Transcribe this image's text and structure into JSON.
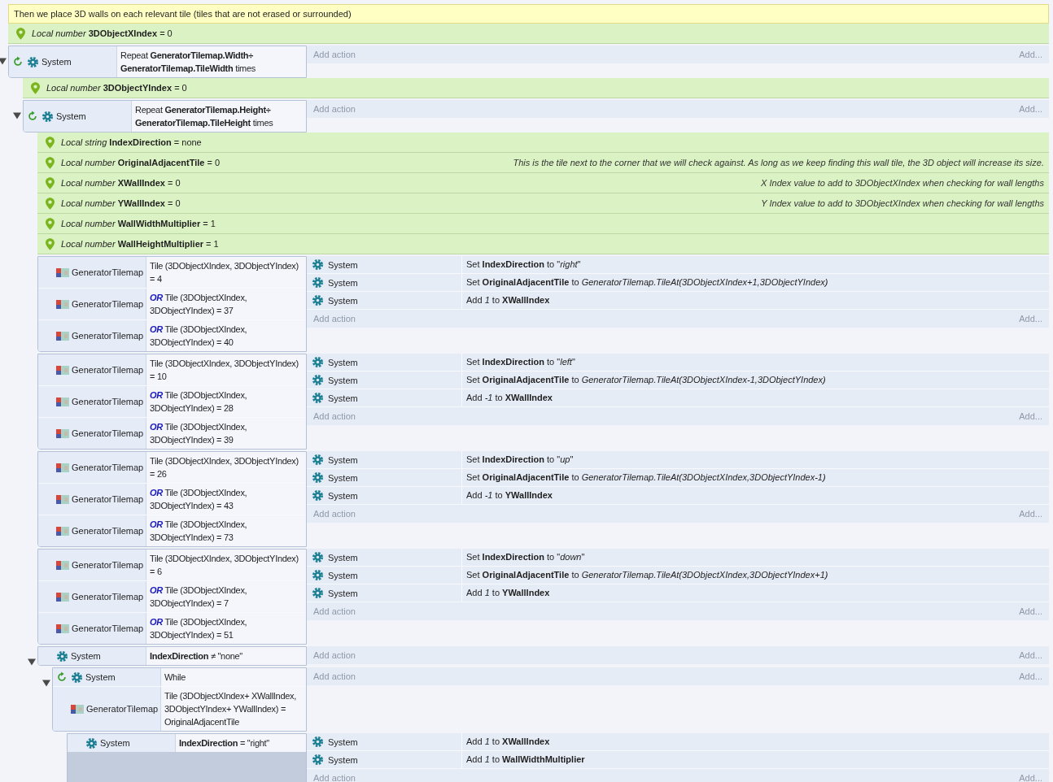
{
  "rows": [
    {
      "kind": "comment",
      "text": "Then we place 3D walls on each relevant tile (tiles that are not erased or surrounded)"
    },
    {
      "kind": "variable",
      "text": "*Local number* **3DObjectXIndex** = 0"
    },
    {
      "kind": "event",
      "expanded": true,
      "conditions": [
        {
          "kind": "system",
          "loop": true,
          "object": "System",
          "text": "Repeat **GeneratorTilemap.Width÷ GeneratorTilemap.TileWidth** times"
        }
      ],
      "add_action": "Add action",
      "add": "Add...",
      "children": [
        {
          "kind": "variable",
          "text": "*Local number* **3DObjectYIndex** = 0"
        },
        {
          "kind": "event",
          "expanded": true,
          "conditions": [
            {
              "kind": "system",
              "loop": true,
              "object": "System",
              "text": "Repeat **GeneratorTilemap.Height÷ GeneratorTilemap.TileHeight** times"
            }
          ],
          "add_action": "Add action",
          "add": "Add...",
          "children": [
            {
              "kind": "variable",
              "text": "*Local string* **IndexDirection** = none"
            },
            {
              "kind": "variable",
              "text": "*Local number* **OriginalAdjacentTile** = 0",
              "comment": "This is the tile next to the corner that we will check against. As long as we keep finding this wall tile, the 3D object will increase its size."
            },
            {
              "kind": "variable",
              "text": "*Local number* **XWallIndex** = 0",
              "comment": "X Index value to add to 3DObjectXIndex when checking for wall lengths"
            },
            {
              "kind": "variable",
              "text": "*Local number* **YWallIndex** = 0",
              "comment": "Y Index value to add to 3DObjectXIndex when checking for wall lengths"
            },
            {
              "kind": "variable",
              "text": "*Local number* **WallWidthMultiplier** = 1"
            },
            {
              "kind": "variable",
              "text": "*Local number* **WallHeightMultiplier** = 1"
            },
            {
              "kind": "event",
              "conditions": [
                {
                  "kind": "tilemap",
                  "loop": false,
                  "object": "GeneratorTilemap",
                  "text": "Tile (3DObjectXIndex, 3DObjectYIndex) = 4"
                },
                {
                  "kind": "tilemap",
                  "loop": false,
                  "object": "GeneratorTilemap",
                  "prefix": "OR",
                  "text": "Tile (3DObjectXIndex, 3DObjectYIndex) = 37"
                },
                {
                  "kind": "tilemap",
                  "loop": false,
                  "object": "GeneratorTilemap",
                  "prefix": "OR",
                  "text": "Tile (3DObjectXIndex, 3DObjectYIndex) = 40"
                }
              ],
              "actions": [
                {
                  "kind": "system",
                  "object": "System",
                  "text": "Set **IndexDirection** to \"*right*\""
                },
                {
                  "kind": "system",
                  "object": "System",
                  "text": "Set **OriginalAdjacentTile** to *GeneratorTilemap.TileAt(3DObjectXIndex+1,3DObjectYIndex)*"
                },
                {
                  "kind": "system",
                  "object": "System",
                  "text": "Add *1* to **XWallIndex**"
                }
              ],
              "add_action": "Add action",
              "add": "Add..."
            },
            {
              "kind": "event",
              "conditions": [
                {
                  "kind": "tilemap",
                  "loop": false,
                  "object": "GeneratorTilemap",
                  "text": "Tile (3DObjectXIndex, 3DObjectYIndex) = 10"
                },
                {
                  "kind": "tilemap",
                  "loop": false,
                  "object": "GeneratorTilemap",
                  "prefix": "OR",
                  "text": "Tile (3DObjectXIndex, 3DObjectYIndex) = 28"
                },
                {
                  "kind": "tilemap",
                  "loop": false,
                  "object": "GeneratorTilemap",
                  "prefix": "OR",
                  "text": "Tile (3DObjectXIndex, 3DObjectYIndex) = 39"
                }
              ],
              "actions": [
                {
                  "kind": "system",
                  "object": "System",
                  "text": "Set **IndexDirection** to \"*left*\""
                },
                {
                  "kind": "system",
                  "object": "System",
                  "text": "Set **OriginalAdjacentTile** to *GeneratorTilemap.TileAt(3DObjectXIndex-1,3DObjectYIndex)*"
                },
                {
                  "kind": "system",
                  "object": "System",
                  "text": "Add *-1* to **XWallIndex**"
                }
              ],
              "add_action": "Add action",
              "add": "Add..."
            },
            {
              "kind": "event",
              "conditions": [
                {
                  "kind": "tilemap",
                  "loop": false,
                  "object": "GeneratorTilemap",
                  "text": "Tile (3DObjectXIndex, 3DObjectYIndex) = 26"
                },
                {
                  "kind": "tilemap",
                  "loop": false,
                  "object": "GeneratorTilemap",
                  "prefix": "OR",
                  "text": "Tile (3DObjectXIndex, 3DObjectYIndex) = 43"
                },
                {
                  "kind": "tilemap",
                  "loop": false,
                  "object": "GeneratorTilemap",
                  "prefix": "OR",
                  "text": "Tile (3DObjectXIndex, 3DObjectYIndex) = 73"
                }
              ],
              "actions": [
                {
                  "kind": "system",
                  "object": "System",
                  "text": "Set **IndexDirection** to \"*up*\""
                },
                {
                  "kind": "system",
                  "object": "System",
                  "text": "Set **OriginalAdjacentTile** to *GeneratorTilemap.TileAt(3DObjectXIndex,3DObjectYIndex-1)*"
                },
                {
                  "kind": "system",
                  "object": "System",
                  "text": "Add *-1* to **YWallIndex**"
                }
              ],
              "add_action": "Add action",
              "add": "Add..."
            },
            {
              "kind": "event",
              "conditions": [
                {
                  "kind": "tilemap",
                  "loop": false,
                  "object": "GeneratorTilemap",
                  "text": "Tile (3DObjectXIndex, 3DObjectYIndex) = 6"
                },
                {
                  "kind": "tilemap",
                  "loop": false,
                  "object": "GeneratorTilemap",
                  "prefix": "OR",
                  "text": "Tile (3DObjectXIndex, 3DObjectYIndex) = 7"
                },
                {
                  "kind": "tilemap",
                  "loop": false,
                  "object": "GeneratorTilemap",
                  "prefix": "OR",
                  "text": "Tile (3DObjectXIndex, 3DObjectYIndex) = 51"
                }
              ],
              "actions": [
                {
                  "kind": "system",
                  "object": "System",
                  "text": "Set **IndexDirection** to \"*down*\""
                },
                {
                  "kind": "system",
                  "object": "System",
                  "text": "Set **OriginalAdjacentTile** to *GeneratorTilemap.TileAt(3DObjectXIndex,3DObjectYIndex+1)*"
                },
                {
                  "kind": "system",
                  "object": "System",
                  "text": "Add *1* to **YWallIndex**"
                }
              ],
              "add_action": "Add action",
              "add": "Add..."
            },
            {
              "kind": "event",
              "expanded": true,
              "conditions": [
                {
                  "kind": "system",
                  "loop": false,
                  "object": "System",
                  "text": "**IndexDirection** ≠ \"none\""
                }
              ],
              "add_action": "Add action",
              "add": "Add...",
              "children": [
                {
                  "kind": "event",
                  "expanded": true,
                  "conditions": [
                    {
                      "kind": "system",
                      "loop": true,
                      "object": "System",
                      "text": "While"
                    },
                    {
                      "kind": "tilemap",
                      "loop": false,
                      "object": "GeneratorTilemap",
                      "text": "Tile (3DObjectXIndex+ XWallIndex, 3DObjectYIndex+ YWallIndex) = OriginalAdjacentTile"
                    }
                  ],
                  "add_action": "Add action",
                  "add": "Add...",
                  "children": [
                    {
                      "kind": "event",
                      "conditions": [
                        {
                          "kind": "system",
                          "loop": false,
                          "object": "System",
                          "text": "**IndexDirection** = \"right\""
                        }
                      ],
                      "actions": [
                        {
                          "kind": "system",
                          "object": "System",
                          "text": "Add *1* to **XWallIndex**"
                        },
                        {
                          "kind": "system",
                          "object": "System",
                          "text": "Add *1* to **WallWidthMultiplier**"
                        }
                      ],
                      "add_action": "Add action",
                      "add": "Add..."
                    }
                  ]
                }
              ]
            }
          ]
        }
      ]
    }
  ]
}
